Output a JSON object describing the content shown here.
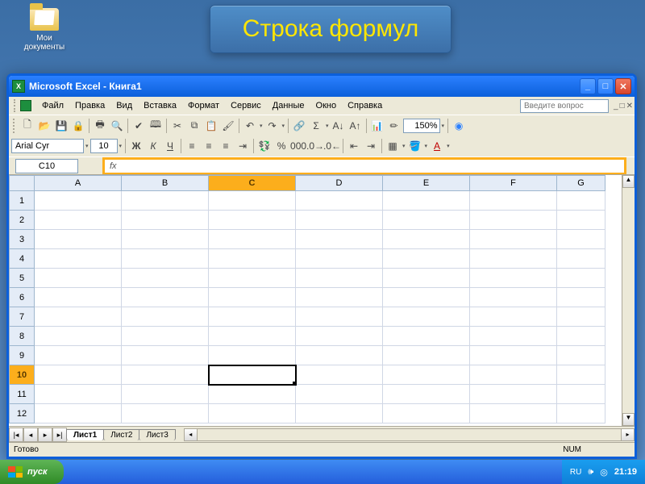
{
  "desktop": {
    "my_docs": "Мои документы"
  },
  "callout": {
    "text": "Строка формул"
  },
  "titlebar": {
    "text": "Microsoft Excel - Книга1"
  },
  "menu": {
    "file": "Файл",
    "edit": "Правка",
    "view": "Вид",
    "insert": "Вставка",
    "format": "Формат",
    "tools": "Сервис",
    "data": "Данные",
    "window": "Окно",
    "help": "Справка",
    "ask_placeholder": "Введите вопрос"
  },
  "format_toolbar": {
    "font": "Arial Cyr",
    "size": "10",
    "zoom": "150%"
  },
  "namebox": {
    "cell": "C10"
  },
  "formula": {
    "fx_label": "fx",
    "value": ""
  },
  "columns": [
    "A",
    "B",
    "C",
    "D",
    "E",
    "F",
    "G"
  ],
  "rows": [
    "1",
    "2",
    "3",
    "4",
    "5",
    "6",
    "7",
    "8",
    "9",
    "10",
    "11",
    "12"
  ],
  "active": {
    "row": "10",
    "col": "C"
  },
  "sheets": {
    "s1": "Лист1",
    "s2": "Лист2",
    "s3": "Лист3"
  },
  "status": {
    "ready": "Готово",
    "num": "NUM"
  },
  "taskbar": {
    "start": "пуск",
    "lang": "RU",
    "time": "21:19"
  }
}
